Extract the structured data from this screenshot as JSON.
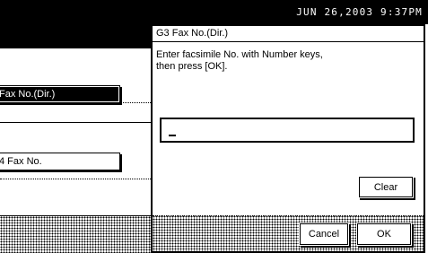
{
  "status_bar": {
    "datetime": "JUN  26,2003  9:37PM"
  },
  "background_screen": {
    "items": [
      {
        "label": "Fax No.(Dir.)",
        "selected": true
      },
      {
        "label": "4 Fax No.",
        "selected": false
      }
    ]
  },
  "dialog": {
    "title": "G3 Fax No.(Dir.)",
    "message": "Enter facsimile No. with Number keys,\nthen press [OK].",
    "input_value": "",
    "clear_label": "Clear",
    "cancel_label": "Cancel",
    "ok_label": "OK"
  }
}
